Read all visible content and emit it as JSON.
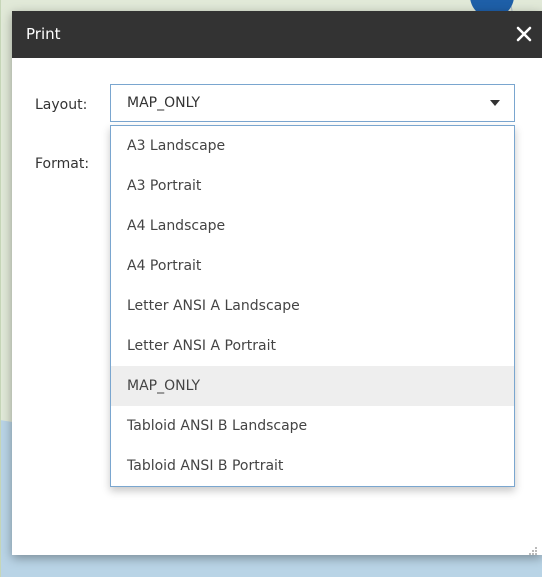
{
  "dialog": {
    "title": "Print",
    "close_icon": "close-icon"
  },
  "form": {
    "layout_label": "Layout:",
    "format_label": "Format:",
    "layout_selected": "MAP_ONLY"
  },
  "layout_options": [
    "A3 Landscape",
    "A3 Portrait",
    "A4 Landscape",
    "A4 Portrait",
    "Letter ANSI A Landscape",
    "Letter ANSI A Portrait",
    "MAP_ONLY",
    "Tabloid ANSI B Landscape",
    "Tabloid ANSI B Portrait"
  ],
  "colors": {
    "titlebar": "#333333",
    "select_border": "#7aa6cf",
    "selected_option_bg": "#eeeeee"
  }
}
